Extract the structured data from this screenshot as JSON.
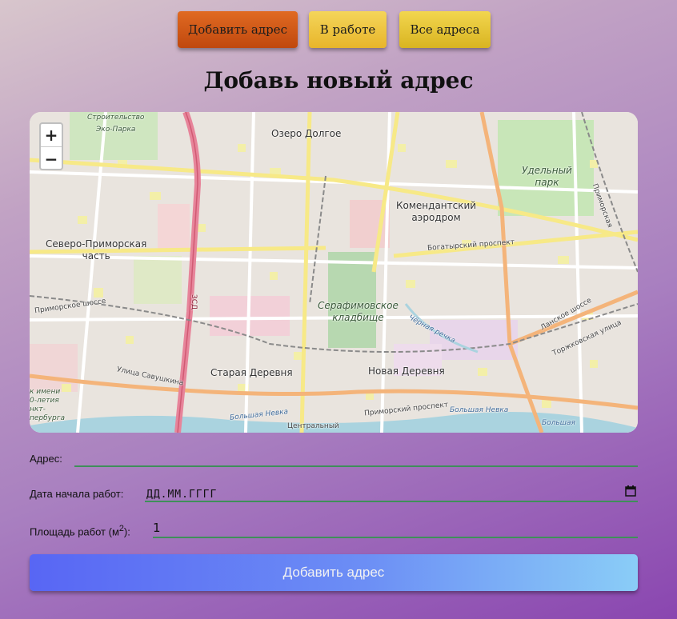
{
  "nav": {
    "add_label": "Добавить адрес",
    "work_label": "В работе",
    "all_label": "Все адреса"
  },
  "page_title": "Добавь новый адрес",
  "map": {
    "zoom_in": "+",
    "zoom_out": "−",
    "labels": {
      "stroitelstvo": "Строительство\nЭко-Парка",
      "ozero": "Озеро Долгое",
      "udelny": "Удельный\nпарк",
      "komend": "Комендантский\nаэродром",
      "severo": "Северо-Приморская\nчасть",
      "bogatyrsky": "Богатырский проспект",
      "primorskoe": "Приморское шоссе",
      "serafim": "Серафимовское\nкладбище",
      "chernaya": "Чёрная речка",
      "lanskoe": "Ланское шоссе",
      "torzhk": "Торжковская улица",
      "savush": "Улица Савушкина",
      "staraya": "Старая Деревня",
      "novaya": "Новая Деревня",
      "primorsky_pr": "Приморский проспект",
      "bolshaya_nevka": "Большая Невка",
      "bolshaya_nevka2": "Большая Невка",
      "bolshaya": "Большая",
      "centralny": "Центральный",
      "park_imeni": "к имени\n0-летия\nнкт-\nпербурга",
      "primorsk_rail": "Приморская",
      "zsd": "ЗСД"
    }
  },
  "form": {
    "address_label": "Адрес:",
    "address_value": "",
    "date_label": "Дата начала работ:",
    "date_placeholder": "ДД.ММ.ГГГГ",
    "area_label_prefix": "Площадь работ (м",
    "area_label_sup": "2",
    "area_label_suffix": "):",
    "area_value": "1"
  },
  "submit_label": "Добавить адрес"
}
